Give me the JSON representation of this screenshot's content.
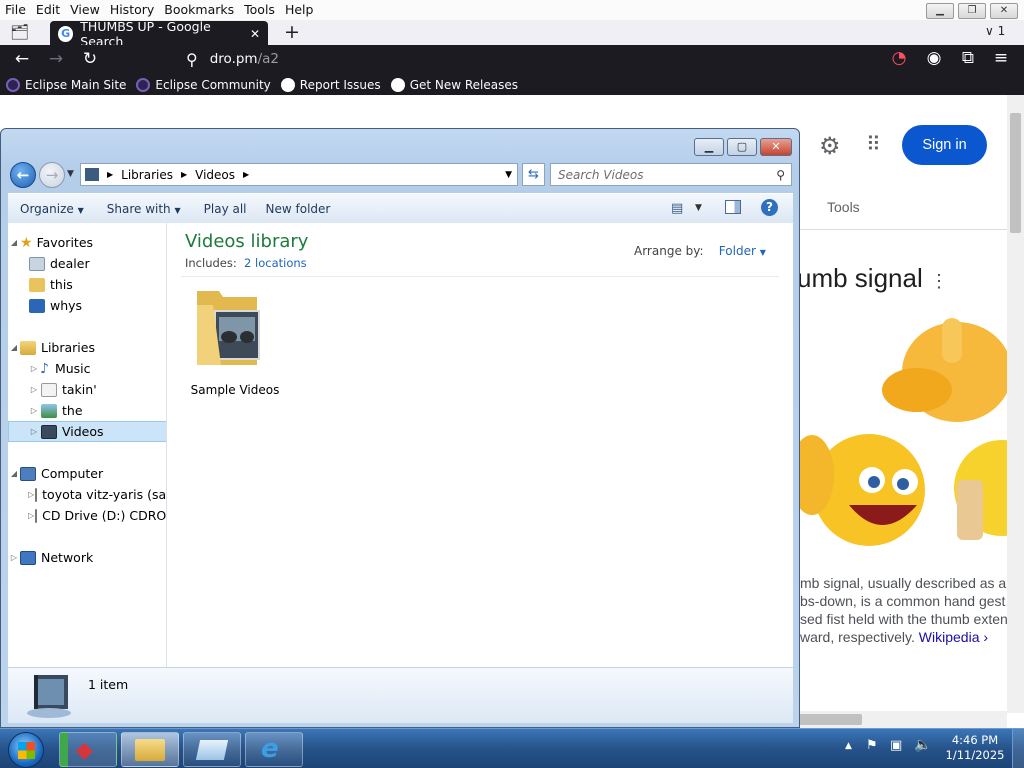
{
  "browser": {
    "menu": [
      "File",
      "Edit",
      "View",
      "History",
      "Bookmarks",
      "Tools",
      "Help"
    ],
    "tab_title": "THUMBS UP - Google Search",
    "tab_count": "1",
    "url_host": "dro.pm",
    "url_path": "/a2",
    "bookmarks": [
      "Eclipse Main Site",
      "Eclipse Community",
      "Report Issues",
      "Get New Releases"
    ]
  },
  "google": {
    "sign_in": "Sign in",
    "tools": "Tools",
    "kp_title": "umb signal",
    "kp_lines": [
      "mb signal, usually described as a",
      "bs-down, is a common hand gest",
      "sed fist held with the thumb exten",
      "ward, respectively."
    ],
    "kp_link": "Wikipedia ›"
  },
  "explorer": {
    "breadcrumb": [
      "Libraries",
      "Videos"
    ],
    "search_placeholder": "Search Videos",
    "commands": [
      "Organize",
      "Share with",
      "Play all",
      "New folder"
    ],
    "tree": {
      "favorites": "Favorites",
      "fav_items": [
        "dealer",
        "this",
        "whys"
      ],
      "libraries": "Libraries",
      "lib_items": [
        "Music",
        "takin'",
        "the",
        "Videos"
      ],
      "computer": "Computer",
      "comp_items": [
        "toyota vitz-yaris (sar",
        "CD Drive (D:) CDROM"
      ],
      "network": "Network"
    },
    "library_title": "Videos library",
    "includes_label": "Includes:",
    "includes_link": "2 locations",
    "arrange_label": "Arrange by:",
    "arrange_value": "Folder",
    "items": [
      {
        "name": "Sample Videos"
      }
    ],
    "status": "1 item"
  },
  "taskbar": {
    "time": "4:46 PM",
    "date": "1/11/2025"
  }
}
